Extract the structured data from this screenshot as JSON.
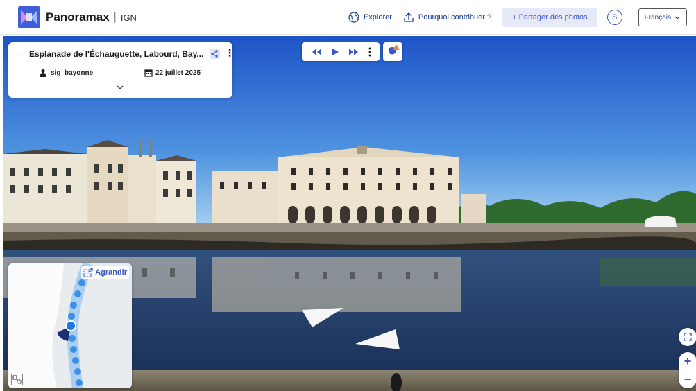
{
  "header": {
    "brand": "Panoramax",
    "brand_sep": "|",
    "brand_sub": "IGN",
    "explore_label": "Explorer",
    "why_label": "Pourquoi contribuer ?",
    "share_label": "+ Partager des photos",
    "avatar_letter": "S",
    "language": "Français"
  },
  "card": {
    "title": "Esplanade de l'Échauguette, Labourd, Bay...",
    "author": "sig_bayonne",
    "date": "22 juillet 2025"
  },
  "minimap": {
    "expand_label": "Agrandir"
  },
  "controls": {
    "zoom_in": "+",
    "zoom_out": "−"
  },
  "colors": {
    "accent": "#3956c9",
    "sky_top": "#1e57c9",
    "sky_bottom": "#8fc3ec",
    "water": "#1f3d6a"
  }
}
